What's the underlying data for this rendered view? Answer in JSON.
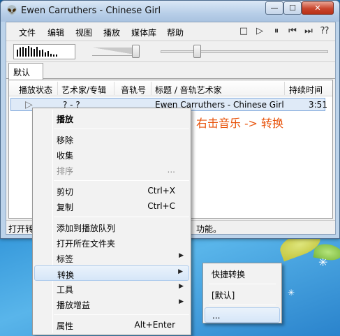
{
  "window": {
    "title": "Ewen Carruthers - Chinese Girl",
    "min_glyph": "—",
    "max_glyph": "☐",
    "close_glyph": "✕"
  },
  "menubar": [
    "文件",
    "编辑",
    "视图",
    "播放",
    "媒体库",
    "帮助"
  ],
  "toolbar": {
    "buttons": [
      "stop-icon",
      "play-icon",
      "pause-icon",
      "previous-icon",
      "next-icon",
      "random-icon"
    ],
    "glyphs": [
      "□",
      "▷",
      "⏸",
      "⏮",
      "⏭",
      "⁇"
    ]
  },
  "tabs": [
    "默认"
  ],
  "list": {
    "columns": [
      "播放状态",
      "艺术家/专辑",
      "音轨号",
      "标题 / 音轨艺术家",
      "持续时间"
    ],
    "rows": [
      {
        "status": "▷",
        "artist_album": "? - ?",
        "track": "",
        "title": "Ewen Carruthers - Chinese Girl",
        "duration": "3:51"
      }
    ]
  },
  "status": {
    "left": "打开转",
    "right": "功能。"
  },
  "annotation": "右击音乐 -> 转换",
  "context_menu": {
    "items": [
      {
        "label": "播放",
        "shortcut": "",
        "bold": true
      },
      {
        "label": "移除",
        "shortcut": ""
      },
      {
        "label": "收集",
        "shortcut": ""
      },
      {
        "label": "排序",
        "shortcut": "...",
        "disabled": true
      },
      {
        "label": "剪切",
        "shortcut": "Ctrl+X"
      },
      {
        "label": "复制",
        "shortcut": "Ctrl+C"
      },
      {
        "label": "添加到播放队列",
        "shortcut": ""
      },
      {
        "label": "打开所在文件夹",
        "shortcut": ""
      },
      {
        "label": "标签",
        "shortcut": "",
        "submenu": true
      },
      {
        "label": "转换",
        "shortcut": "",
        "submenu": true,
        "highlighted": true
      },
      {
        "label": "工具",
        "shortcut": "",
        "submenu": true
      },
      {
        "label": "播放增益",
        "shortcut": "",
        "submenu": true
      },
      {
        "label": "属性",
        "shortcut": "Alt+Enter"
      }
    ],
    "submenu_arrow": "▶"
  },
  "convert_submenu": {
    "items": [
      "快捷转换",
      "[默认]",
      "..."
    ]
  },
  "colors": {
    "accent": "#e8540c",
    "selection": "#dfeaf7",
    "close_button": "#c9452d"
  }
}
